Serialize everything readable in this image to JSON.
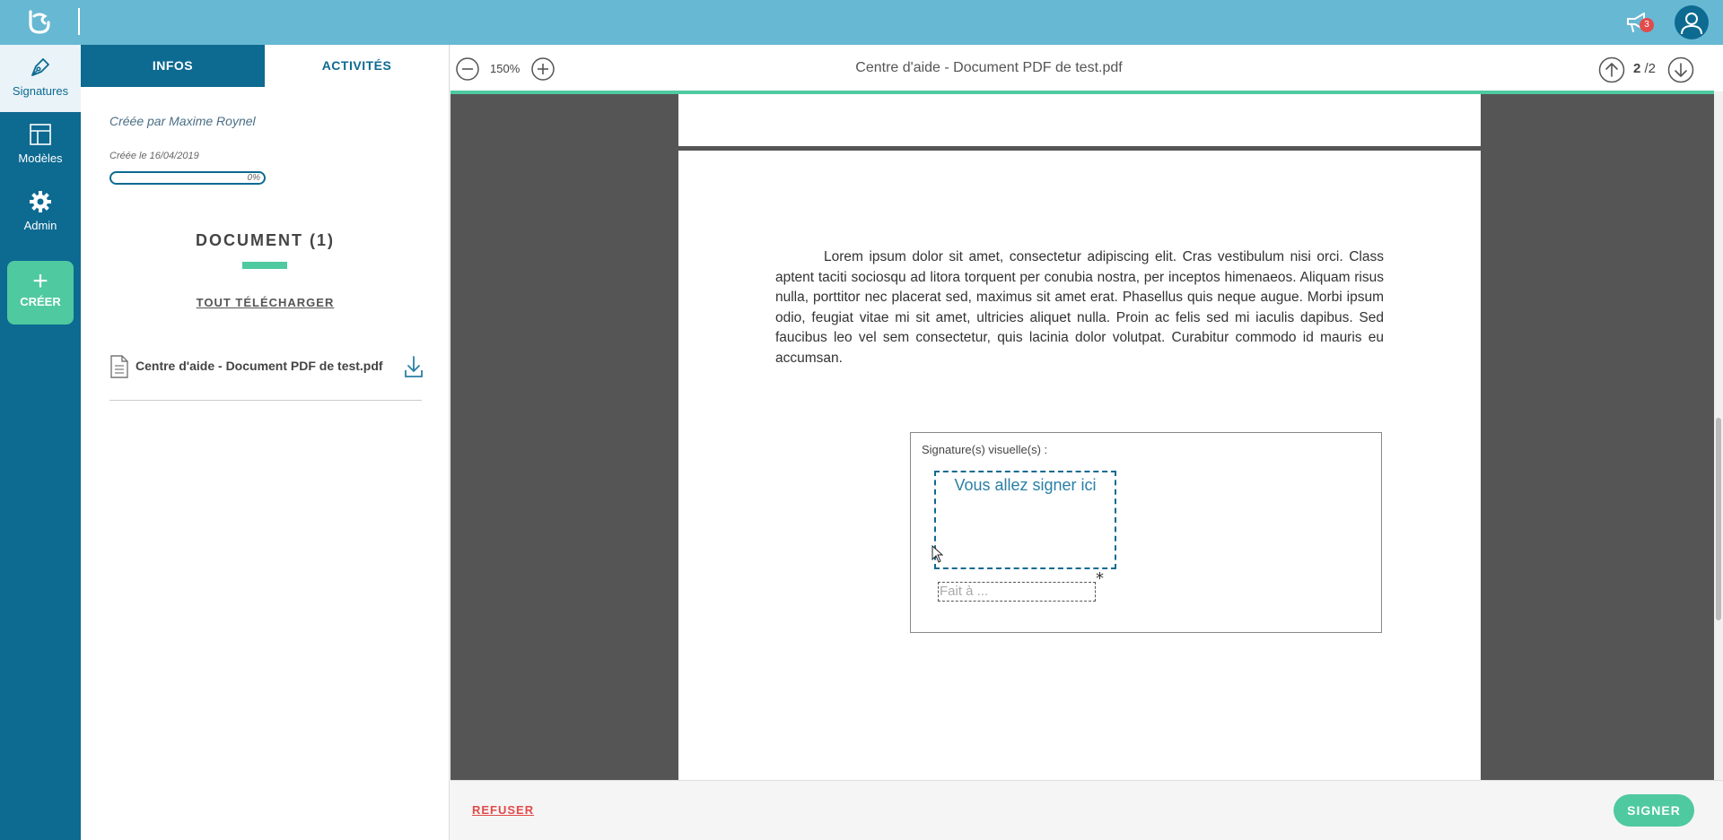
{
  "nav": {
    "items": [
      {
        "label": "Signatures",
        "icon": "pen-icon",
        "active": true
      },
      {
        "label": "Modèles",
        "icon": "layout-icon",
        "active": false
      },
      {
        "label": "Admin",
        "icon": "gear-icon",
        "active": false
      }
    ],
    "create_label": "CRÉER"
  },
  "header": {
    "notification_count": "3"
  },
  "info_panel": {
    "tabs": [
      {
        "label": "INFOS",
        "active": true
      },
      {
        "label": "ACTIVITÉS",
        "active": false
      }
    ],
    "created_by": "Créée par Maxime Roynel",
    "created_date": "Créée le 16/04/2019",
    "progress_text": "0%",
    "progress_value": 0,
    "document_heading": "DOCUMENT (1)",
    "download_all_label": "TOUT TÉLÉCHARGER",
    "files": [
      {
        "name": "Centre d'aide - Document PDF de test.pdf"
      }
    ]
  },
  "viewer": {
    "zoom_level": "150%",
    "title": "Centre d'aide - Document PDF de test.pdf",
    "current_page": "2",
    "total_pages": "/2",
    "body_text": "Lorem ipsum dolor sit amet, consectetur adipiscing elit. Cras vestibulum nisi orci. Class aptent taciti sociosqu ad litora torquent per conubia nostra, per inceptos himenaeos. Aliquam risus nulla, porttitor nec placerat sed, maximus sit amet erat. Phasellus quis neque augue. Morbi ipsum odio, feugiat vitae mi sit amet, ultricies aliquet nulla. Proin ac felis sed mi iaculis dapibus. Sed faucibus leo vel sem consectetur, quis lacinia dolor volutpat. Curabitur commodo id mauris eu accumsan.",
    "signature_label": "Signature(s) visuelle(s) :",
    "signature_zone_text": "Vous allez signer ici",
    "required_marker": "*",
    "place_placeholder": "Fait à ..."
  },
  "footer": {
    "refuse_label": "REFUSER",
    "sign_label": "SIGNER"
  },
  "colors": {
    "topbar": "#67b8d3",
    "nav": "#0d6a91",
    "accent": "#4fc9a0",
    "danger": "#e24b4b"
  }
}
